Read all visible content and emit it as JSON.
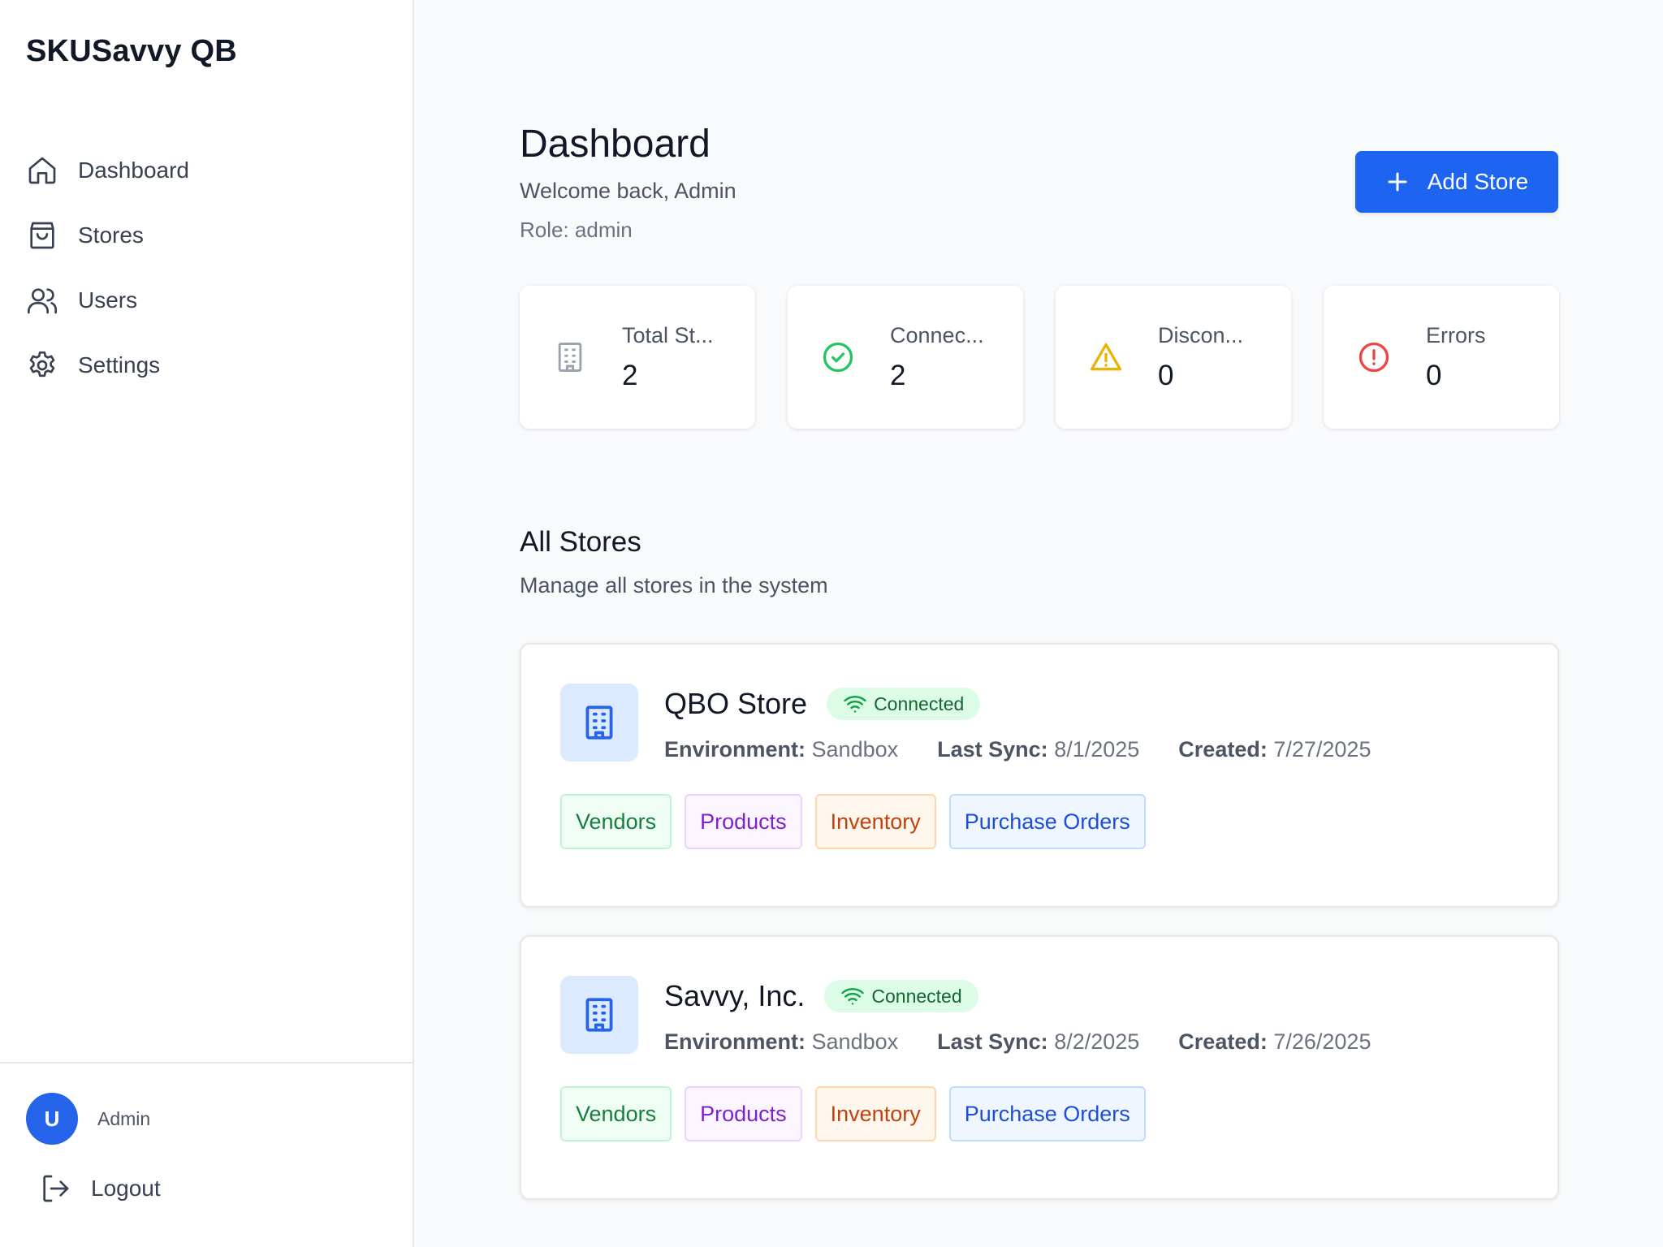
{
  "app": {
    "title": "SKUSavvy QB"
  },
  "sidebar": {
    "items": [
      {
        "label": "Dashboard",
        "icon": "home-icon"
      },
      {
        "label": "Stores",
        "icon": "shopping-bag-icon"
      },
      {
        "label": "Users",
        "icon": "users-icon"
      },
      {
        "label": "Settings",
        "icon": "gear-icon"
      }
    ],
    "user": {
      "avatar_letter": "U",
      "name": "Admin"
    },
    "logout_label": "Logout"
  },
  "header": {
    "title": "Dashboard",
    "welcome": "Welcome back, Admin",
    "role": "Role: admin",
    "add_store_label": "Add Store"
  },
  "stats": [
    {
      "label": "Total St...",
      "value": "2",
      "icon": "building-icon",
      "color": "#9ca3af"
    },
    {
      "label": "Connec...",
      "value": "2",
      "icon": "check-circle-icon",
      "color": "#22c55e"
    },
    {
      "label": "Discon...",
      "value": "0",
      "icon": "warning-icon",
      "color": "#eab308"
    },
    {
      "label": "Errors",
      "value": "0",
      "icon": "alert-circle-icon",
      "color": "#ef4444"
    }
  ],
  "stores_section": {
    "title": "All Stores",
    "subtitle": "Manage all stores in the system",
    "stores": [
      {
        "name": "QBO Store",
        "status": "Connected",
        "environment_label": "Environment:",
        "environment": "Sandbox",
        "last_sync_label": "Last Sync:",
        "last_sync": "8/1/2025",
        "created_label": "Created:",
        "created": "7/27/2025",
        "tags": [
          "Vendors",
          "Products",
          "Inventory",
          "Purchase Orders"
        ]
      },
      {
        "name": "Savvy, Inc.",
        "status": "Connected",
        "environment_label": "Environment:",
        "environment": "Sandbox",
        "last_sync_label": "Last Sync:",
        "last_sync": "8/2/2025",
        "created_label": "Created:",
        "created": "7/26/2025",
        "tags": [
          "Vendors",
          "Products",
          "Inventory",
          "Purchase Orders"
        ]
      }
    ]
  },
  "colors": {
    "accent": "#1d64f0",
    "success": "#22c55e",
    "warning": "#eab308",
    "error": "#ef4444"
  }
}
